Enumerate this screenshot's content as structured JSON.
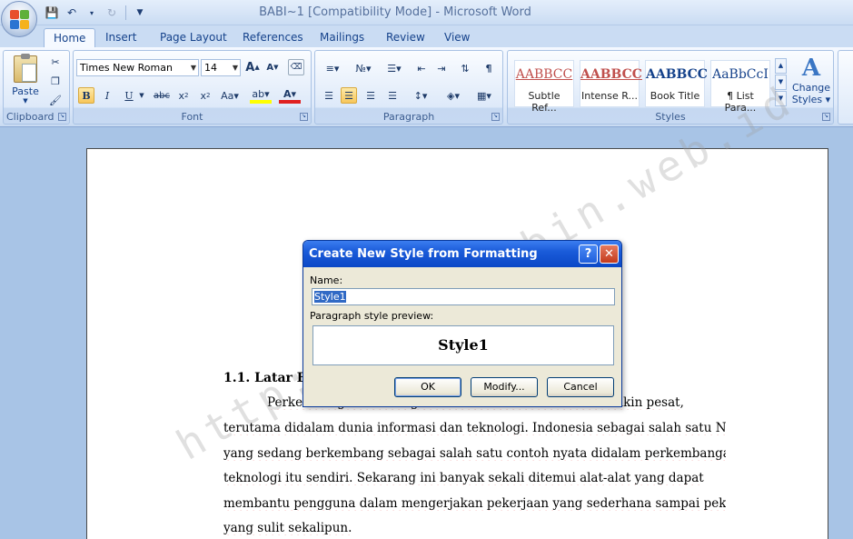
{
  "window": {
    "title": "BABI~1 [Compatibility Mode] - Microsoft Word"
  },
  "tabs": [
    "Home",
    "Insert",
    "Page Layout",
    "References",
    "Mailings",
    "Review",
    "View"
  ],
  "active_tab": "Home",
  "ribbon": {
    "clipboard": {
      "label": "Clipboard",
      "paste_label": "Paste"
    },
    "font": {
      "label": "Font",
      "font_name": "Times New Roman",
      "font_size": "14"
    },
    "paragraph": {
      "label": "Paragraph"
    },
    "styles": {
      "label": "Styles",
      "gallery": [
        {
          "sample": "AABBCC",
          "name": "Subtle Ref...",
          "color": "#c0504d"
        },
        {
          "sample": "AABBCC",
          "name": "Intense R...",
          "color": "#c0504d"
        },
        {
          "sample": "AABBCC",
          "name": "Book Title",
          "color": "#000000"
        },
        {
          "sample": "AaBbCcI",
          "name": "¶ List Para...",
          "color": "#000000"
        }
      ],
      "change_styles_line1": "Change",
      "change_styles_line2": "Styles"
    }
  },
  "document": {
    "heading": "1.1. Latar Be",
    "lines": [
      "Perkembangan teknologi informasi dan komunikasi semakin pesat,",
      "terutama didalam dunia informasi dan teknologi. Indonesia sebagai salah satu Negara",
      "yang sedang berkembang sebagai salah satu contoh nyata didalam perkembangan",
      "teknologi itu sendiri. Sekarang ini banyak sekali ditemui alat-alat yang dapat",
      "membantu pengguna dalam mengerjakan pekerjaan yang sederhana sampai pekerjaan",
      "yang sulit sekalipun."
    ],
    "watermark": "http://mecylebin.web.id"
  },
  "dialog": {
    "title": "Create New Style from Formatting",
    "name_label": "Name:",
    "name_value": "Style1",
    "preview_label": "Paragraph style preview:",
    "preview_text": "Style1",
    "ok_label": "OK",
    "modify_label": "Modify...",
    "cancel_label": "Cancel",
    "help_glyph": "?",
    "close_glyph": "✕"
  }
}
